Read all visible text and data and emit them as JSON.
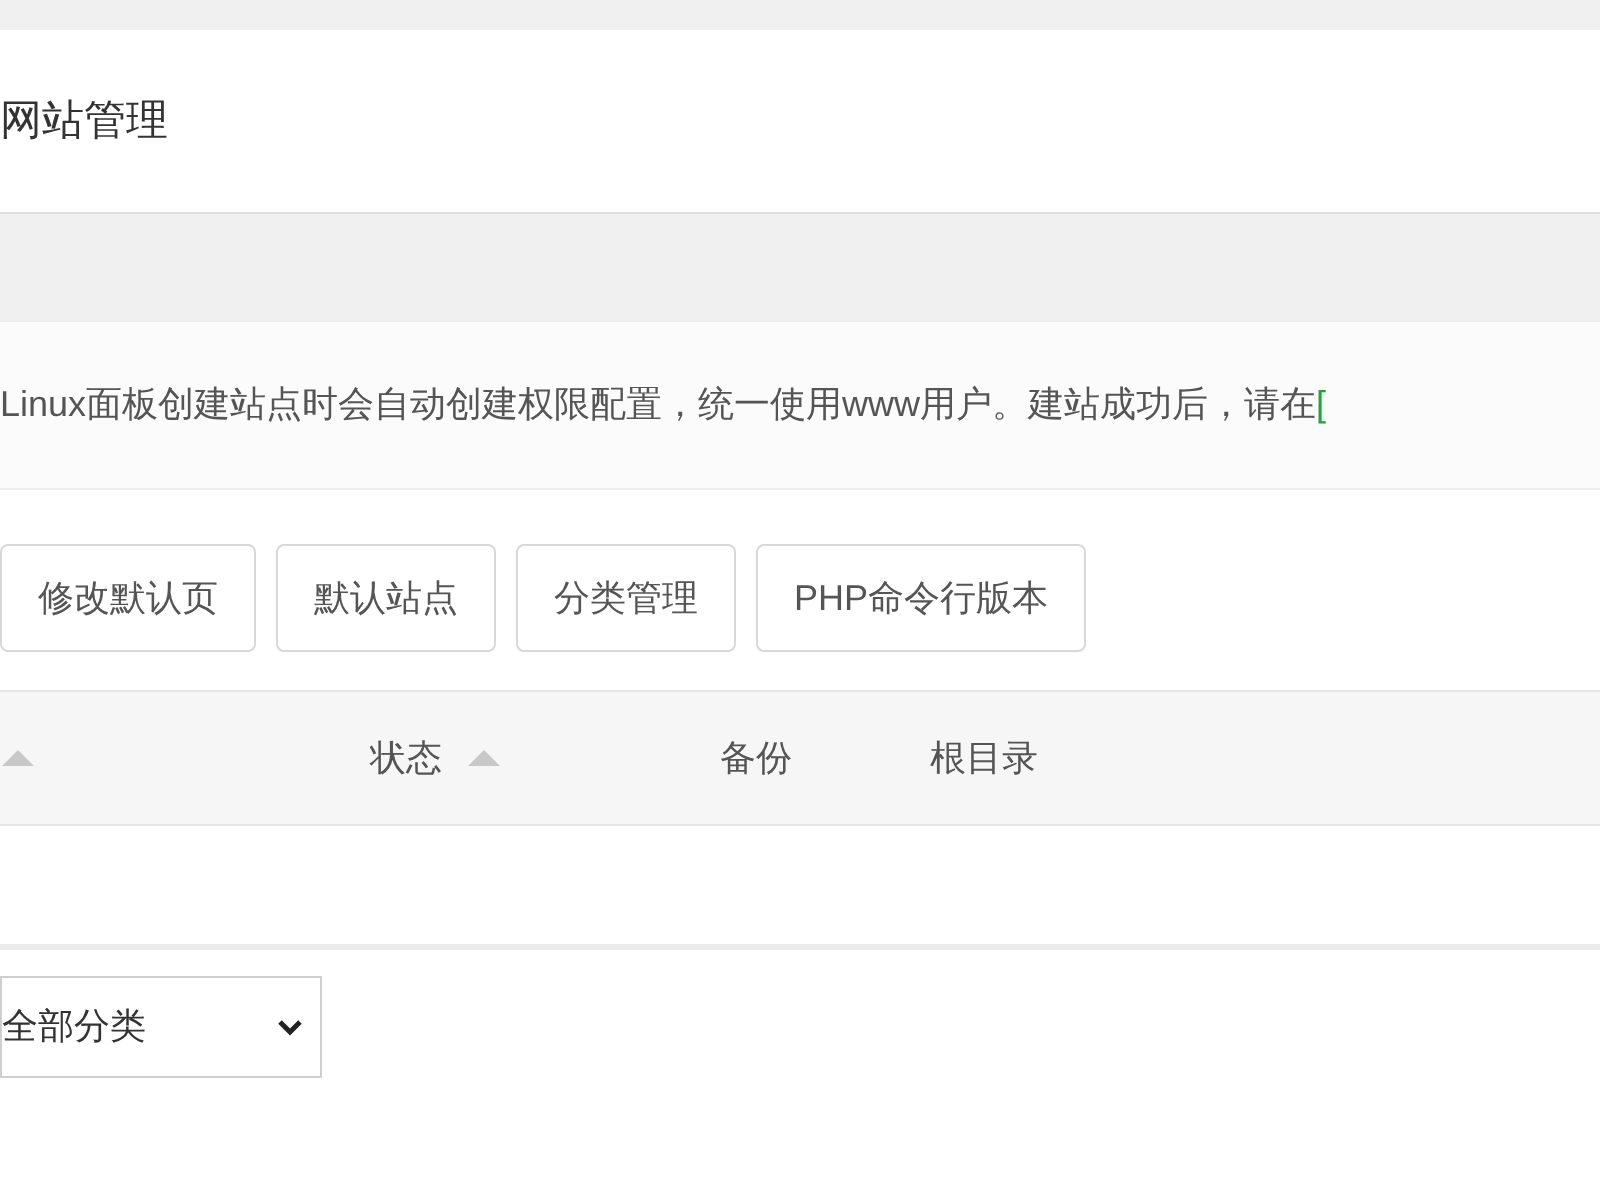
{
  "page_title": "网站管理",
  "notice": {
    "text": "Linux面板创建站点时会自动创建权限配置，统一使用www用户。建站成功后，请在",
    "link": "["
  },
  "buttons": [
    "修改默认页",
    "默认站点",
    "分类管理",
    "PHP命令行版本"
  ],
  "table": {
    "columns": [
      {
        "sortable": true
      },
      {
        "label": "状态",
        "sortable": true
      },
      {
        "label": "备份",
        "sortable": false
      },
      {
        "label": "根目录",
        "sortable": false
      }
    ]
  },
  "category_select": {
    "value": "全部分类"
  }
}
